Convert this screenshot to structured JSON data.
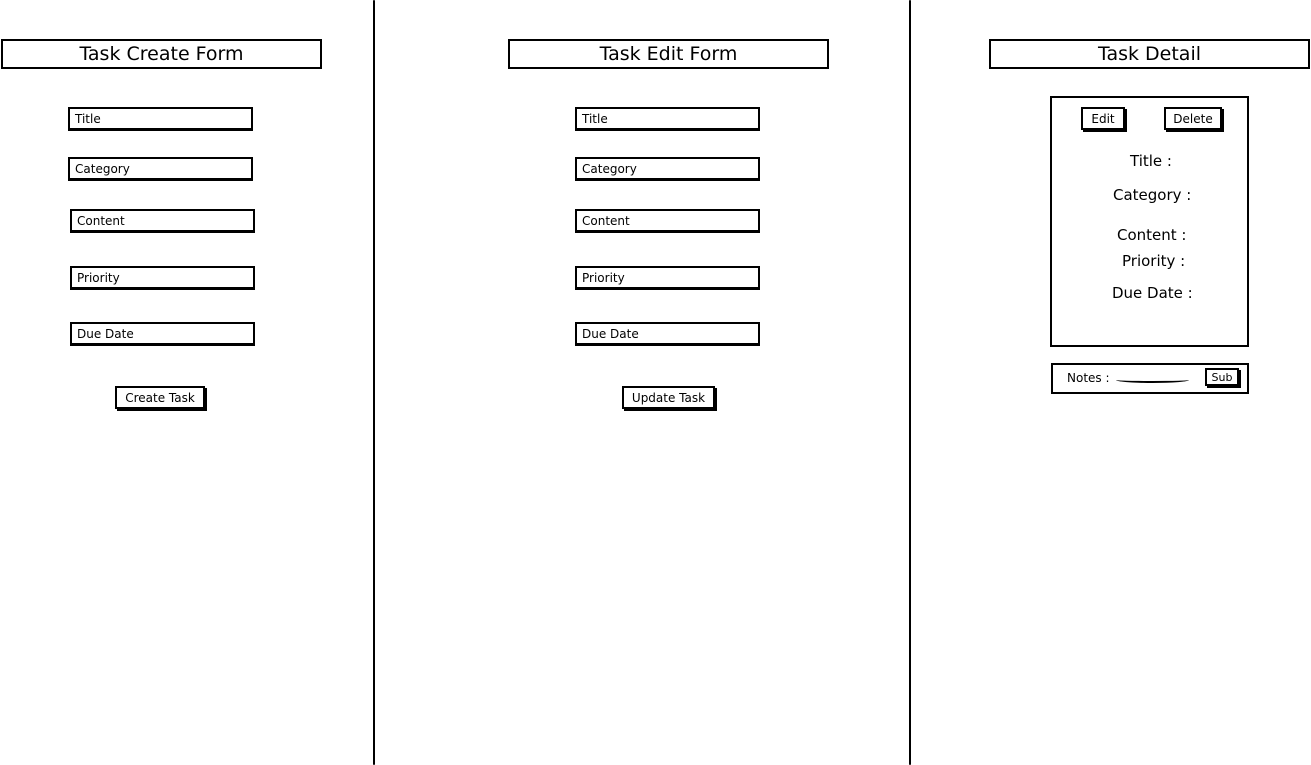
{
  "create_form": {
    "title": "Task Create Form",
    "fields": [
      "Title",
      "Category",
      "Content",
      "Priority",
      "Due Date"
    ],
    "submit_label": "Create Task"
  },
  "edit_form": {
    "title": "Task Edit Form",
    "fields": [
      "Title",
      "Category",
      "Content",
      "Priority",
      "Due Date"
    ],
    "submit_label": "Update Task"
  },
  "detail": {
    "title": "Task Detail",
    "edit_label": "Edit",
    "delete_label": "Delete",
    "labels": [
      "Title :",
      "Category :",
      "Content :",
      "Priority :",
      "Due Date :"
    ],
    "notes_label": "Notes :",
    "notes_submit_label": "Sub"
  }
}
